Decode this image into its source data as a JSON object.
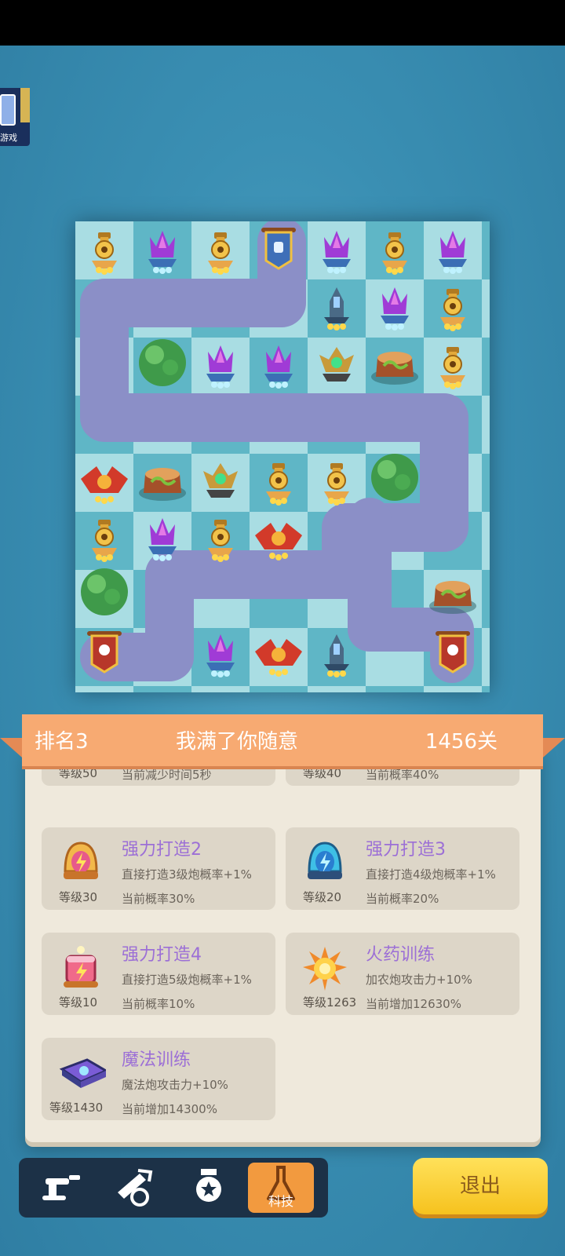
{
  "banner": {
    "rank": "排名3",
    "name": "我满了你随意",
    "level": "1456关"
  },
  "hidden_cards": [
    {
      "level": "等级50",
      "current": "当前减少时间5秒"
    },
    {
      "level": "等级40",
      "current": "当前概率40%"
    }
  ],
  "cards": [
    {
      "title": "强力打造2",
      "desc": "直接打造3级炮概率+1%",
      "level": "等级30",
      "current": "当前概率30%",
      "icon": "gold-bell-icon"
    },
    {
      "title": "强力打造3",
      "desc": "直接打造4级炮概率+1%",
      "level": "等级20",
      "current": "当前概率20%",
      "icon": "blue-bell-icon"
    },
    {
      "title": "强力打造4",
      "desc": "直接打造5级炮概率+1%",
      "level": "等级10",
      "current": "当前概率10%",
      "icon": "lightning-cake-icon"
    },
    {
      "title": "火药训练",
      "desc": "加农炮攻击力+10%",
      "level": "等级1263",
      "current": "当前增加12630%",
      "icon": "explosion-icon"
    },
    {
      "title": "魔法训练",
      "desc": "魔法炮攻击力+10%",
      "level": "等级1430",
      "current": "当前增加14300%",
      "icon": "spellbook-icon"
    }
  ],
  "tabs": [
    {
      "icon": "cannon-icon",
      "label": ""
    },
    {
      "icon": "hammer-icon",
      "label": ""
    },
    {
      "icon": "medal-icon",
      "label": ""
    },
    {
      "icon": "flask-icon",
      "label": "科技",
      "active": true
    }
  ],
  "exit_label": "退出",
  "sidebar": {
    "game_label": "游戏"
  },
  "colors": {
    "background": "#3a8fb3",
    "tile_light": "#a9dde3",
    "tile_dark": "#5fb6c6",
    "path": "#8b8fc7",
    "banner": "#f7aa72",
    "active_tab": "#f29a3f",
    "exit": "#f6c21e"
  }
}
